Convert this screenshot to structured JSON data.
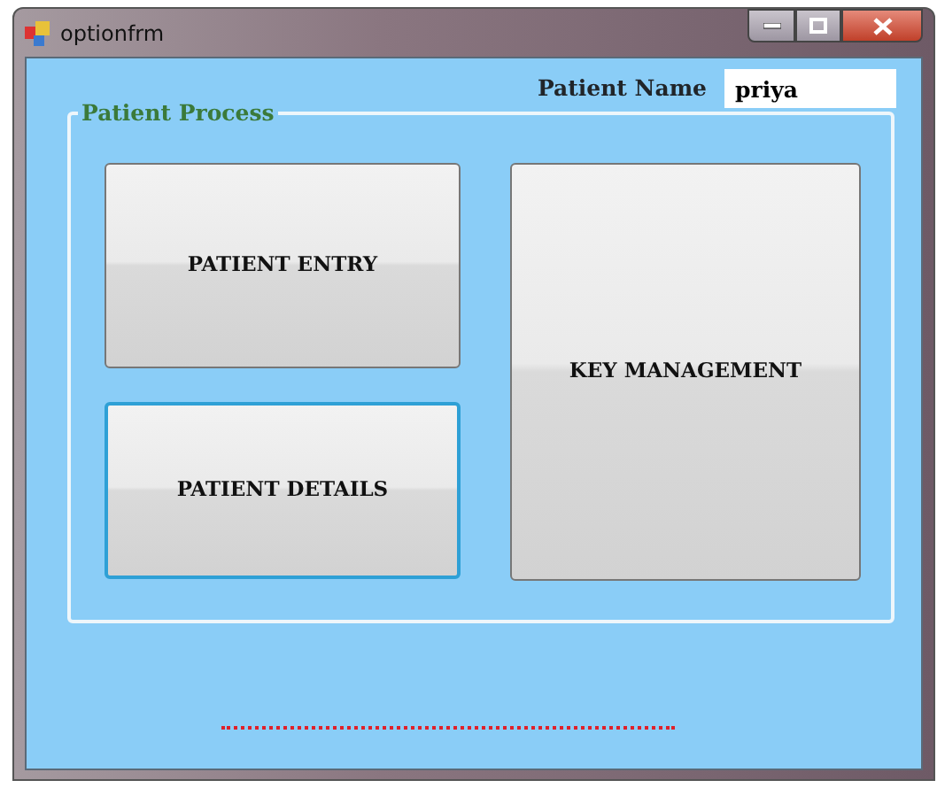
{
  "window": {
    "title": "optionfrm"
  },
  "patient_name": {
    "label": "Patient Name",
    "value": "priya"
  },
  "group": {
    "title": "Patient Process"
  },
  "buttons": [
    {
      "label": "PATIENT ENTRY",
      "focused": false
    },
    {
      "label": "PATIENT DETAILS",
      "focused": true
    },
    {
      "label": "KEY MANAGEMENT",
      "focused": false
    }
  ]
}
